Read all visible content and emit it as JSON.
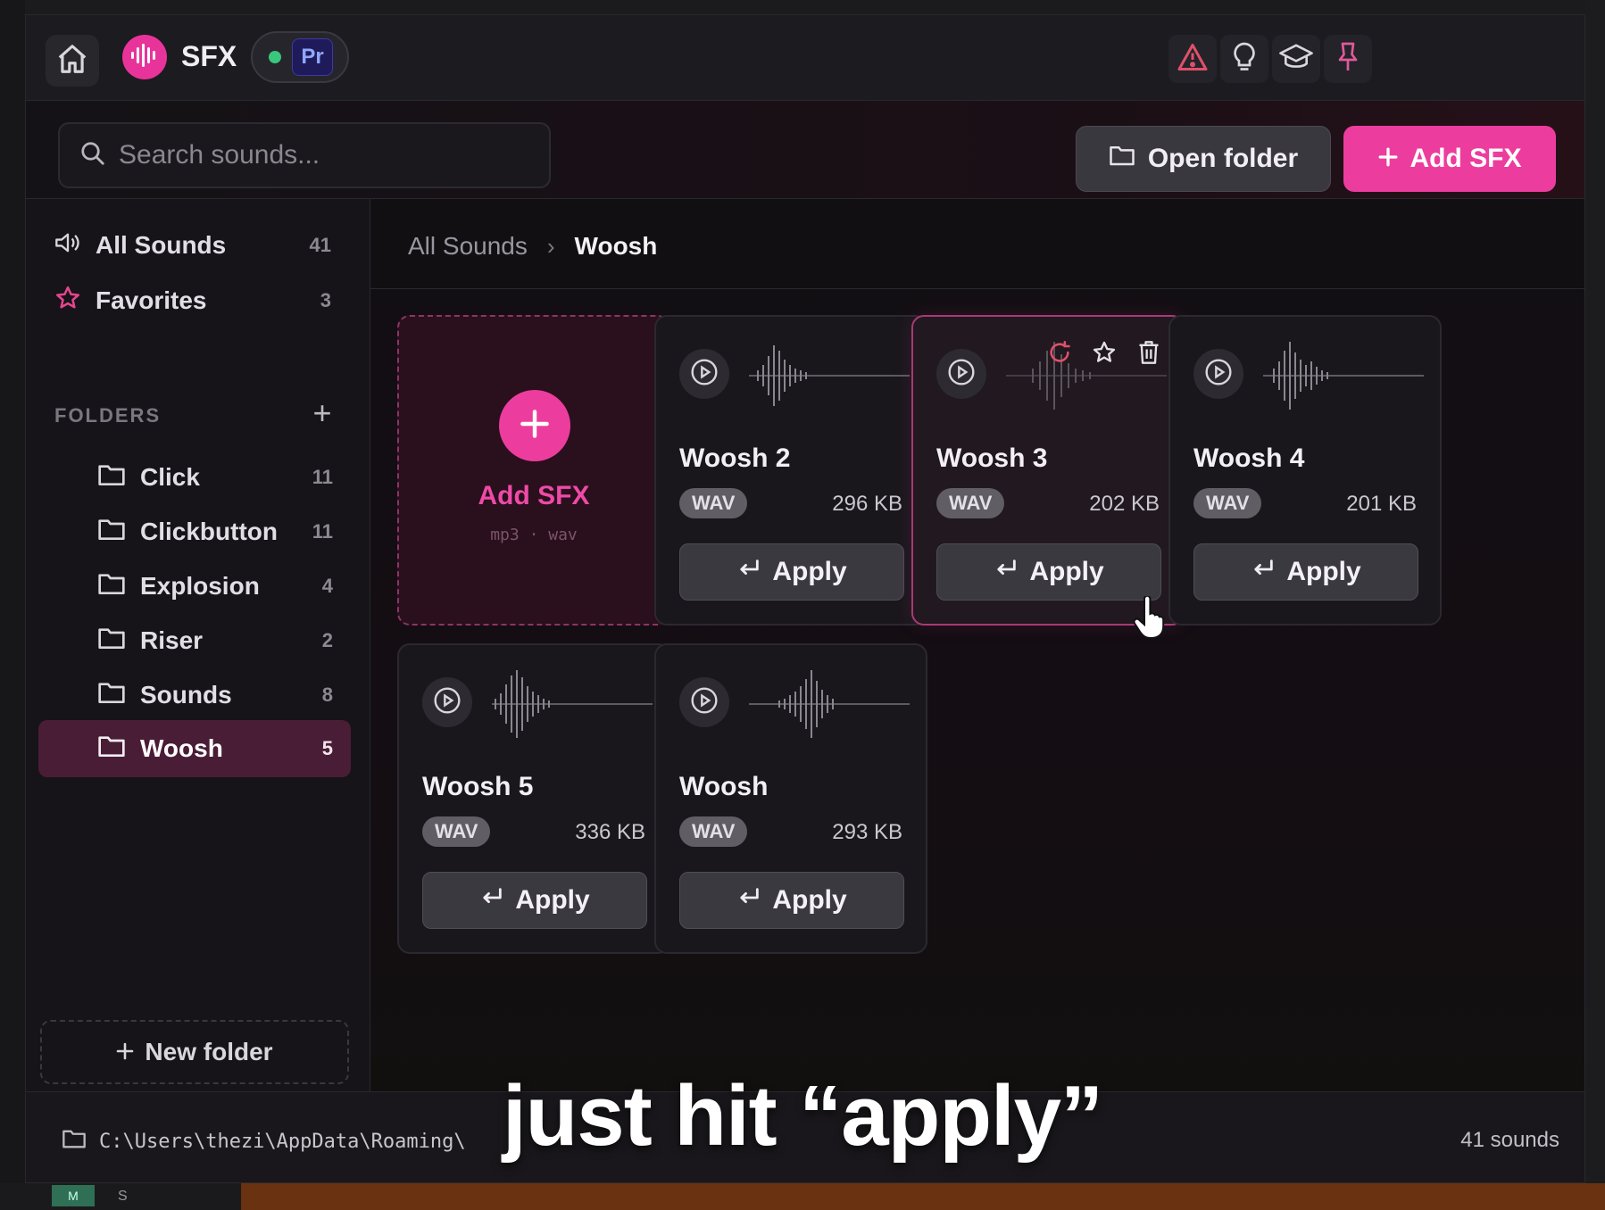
{
  "app": {
    "name": "SFX",
    "host_badge": "Pr"
  },
  "search": {
    "placeholder": "Search sounds..."
  },
  "header": {
    "open_folder_label": "Open folder",
    "add_sfx_label": "Add SFX"
  },
  "sidebar": {
    "all_sounds": {
      "label": "All Sounds",
      "count": "41"
    },
    "favorites": {
      "label": "Favorites",
      "count": "3"
    },
    "folders_label": "FOLDERS",
    "folders": [
      {
        "label": "Click",
        "count": "11"
      },
      {
        "label": "Clickbutton",
        "count": "11"
      },
      {
        "label": "Explosion",
        "count": "4"
      },
      {
        "label": "Riser",
        "count": "2"
      },
      {
        "label": "Sounds",
        "count": "8"
      },
      {
        "label": "Woosh",
        "count": "5",
        "active": true
      }
    ],
    "new_folder_label": "New folder"
  },
  "breadcrumb": {
    "root": "All Sounds",
    "current": "Woosh"
  },
  "add_card": {
    "label": "Add SFX",
    "formats": "mp3 · wav"
  },
  "cards": [
    {
      "title": "Woosh 2",
      "format": "WAV",
      "size": "296 KB",
      "apply": "Apply"
    },
    {
      "title": "Woosh 3",
      "format": "WAV",
      "size": "202 KB",
      "apply": "Apply"
    },
    {
      "title": "Woosh 4",
      "format": "WAV",
      "size": "201 KB",
      "apply": "Apply"
    },
    {
      "title": "Woosh 5",
      "format": "WAV",
      "size": "336 KB",
      "apply": "Apply"
    },
    {
      "title": "Woosh",
      "format": "WAV",
      "size": "293 KB",
      "apply": "Apply"
    }
  ],
  "footer": {
    "path": "C:\\Users\\thezi\\AppData\\Roaming\\",
    "total": "41 sounds"
  },
  "caption": "just hit “apply”",
  "host_bar": {
    "tab_label": "M",
    "label_s": "S"
  },
  "colors": {
    "accent": "#ec3d9e",
    "active_folder": "#4a1d36",
    "status_green": "#38c77d"
  }
}
